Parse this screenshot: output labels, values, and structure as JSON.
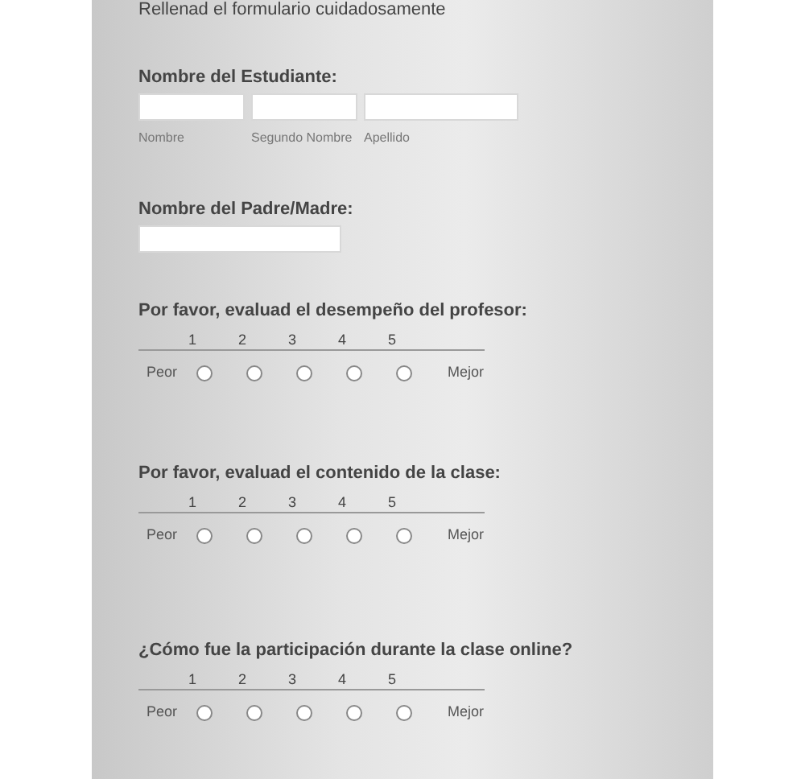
{
  "intro": "Rellenad el formulario cuidadosamente",
  "student": {
    "label": "Nombre del Estudiante:",
    "fields": [
      {
        "sublabel": "Nombre"
      },
      {
        "sublabel": "Segundo Nombre"
      },
      {
        "sublabel": "Apellido"
      }
    ]
  },
  "parent": {
    "label": "Nombre del Padre/Madre:"
  },
  "ratings": [
    {
      "question": "Por favor, evaluad el desempeño del profesor:",
      "scale": [
        "1",
        "2",
        "3",
        "4",
        "5"
      ],
      "low": "Peor",
      "high": "Mejor",
      "options": [
        {
          "selected": false
        },
        {
          "selected": false
        },
        {
          "selected": false
        },
        {
          "selected": false
        },
        {
          "selected": false
        }
      ]
    },
    {
      "question": "Por favor, evaluad el contenido de la clase:",
      "scale": [
        "1",
        "2",
        "3",
        "4",
        "5"
      ],
      "low": "Peor",
      "high": "Mejor",
      "options": [
        {
          "selected": false
        },
        {
          "selected": false
        },
        {
          "selected": false
        },
        {
          "selected": false
        },
        {
          "selected": false
        }
      ]
    },
    {
      "question": "¿Cómo fue la participación durante la clase online?",
      "scale": [
        "1",
        "2",
        "3",
        "4",
        "5"
      ],
      "low": "Peor",
      "high": "Mejor",
      "options": [
        {
          "selected": false
        },
        {
          "selected": false
        },
        {
          "selected": false
        },
        {
          "selected": false
        },
        {
          "selected": false
        }
      ]
    }
  ]
}
